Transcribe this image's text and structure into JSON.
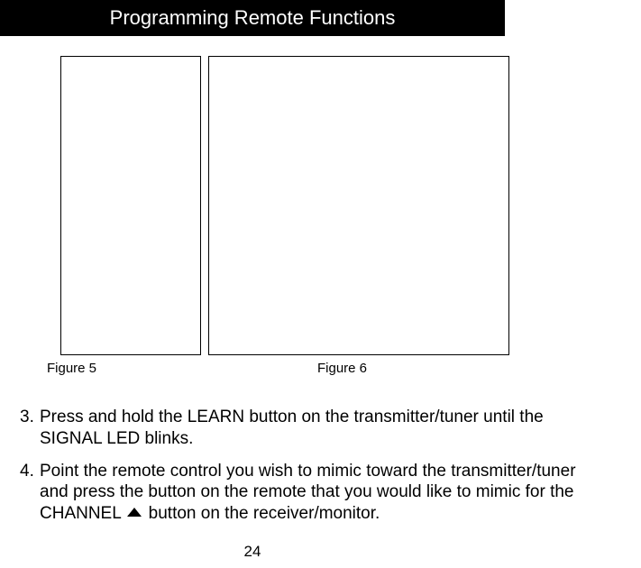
{
  "header": {
    "title": "Programming Remote Functions"
  },
  "figures": {
    "label5": "Figure 5",
    "label6": "Figure 6"
  },
  "steps": {
    "s3": {
      "num": "3.",
      "text": "Press and hold the LEARN button on the transmitter/tuner until the SIGNAL LED blinks."
    },
    "s4": {
      "num": "4.",
      "text_a": "Point the remote control you wish to mimic toward the transmitter/tuner and press the button on the remote that you would like to mimic for the CHANNEL",
      "text_b": "button on the receiver/monitor."
    }
  },
  "page_number": "24"
}
